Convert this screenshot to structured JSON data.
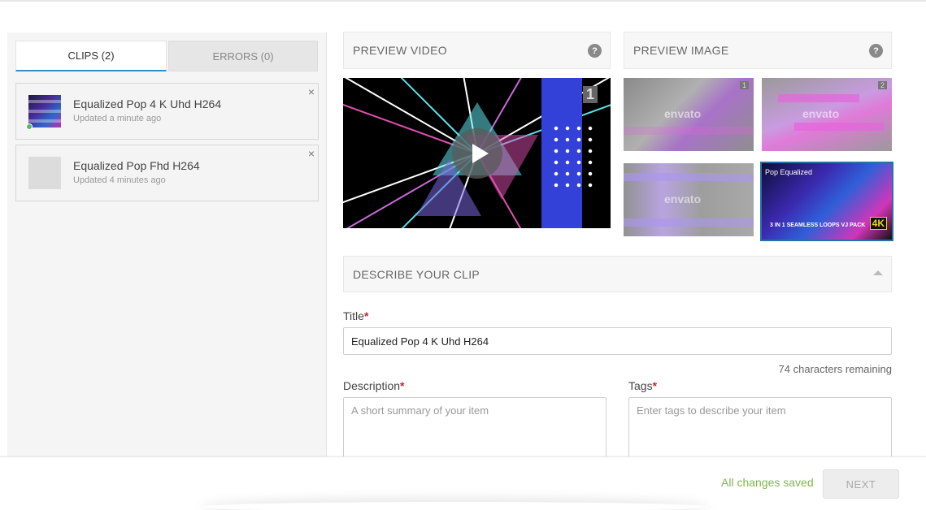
{
  "sidebar": {
    "tabs": [
      {
        "label": "CLIPS (2)",
        "active": true
      },
      {
        "label": "ERRORS (0)",
        "active": false
      }
    ],
    "clips": [
      {
        "title": "Equalized Pop 4 K Uhd H264",
        "updated": "Updated a minute ago",
        "thumbnail": "art",
        "status_color": "#5cb85c",
        "close_icon": "×"
      },
      {
        "title": "Equalized Pop Fhd H264",
        "updated": "Updated 4 minutes ago",
        "thumbnail": "blank",
        "close_icon": "×"
      }
    ]
  },
  "preview_video": {
    "header": "PREVIEW VIDEO",
    "help_icon": "?",
    "overlay_number": "1",
    "play_icon": "play-icon"
  },
  "preview_image": {
    "header": "PREVIEW IMAGE",
    "help_icon": "?",
    "thumbnails": [
      {
        "badge": "1",
        "watermark": "envato",
        "selected": false
      },
      {
        "badge": "2",
        "watermark": "envato",
        "selected": false
      },
      {
        "badge": "",
        "watermark": "envato",
        "selected": false
      },
      {
        "title": "Pop Equalized",
        "subtitle": "3 IN 1 SEAMLESS LOOPS VJ PACK",
        "resolution": "4K",
        "selected": true
      }
    ]
  },
  "describe": {
    "header": "DESCRIBE YOUR CLIP",
    "title_label": "Title",
    "required_mark": "*",
    "title_value": "Equalized Pop 4 K Uhd H264",
    "chars_remaining": "74 characters remaining",
    "description_label": "Description",
    "description_placeholder": "A short summary of your item",
    "tags_label": "Tags",
    "tags_placeholder": "Enter tags to describe your item"
  },
  "footer": {
    "status": "All changes saved",
    "next_label": "NEXT"
  },
  "colors": {
    "accent": "#2f8fc9",
    "required": "#c0262d",
    "saved": "#7db945",
    "selected_border": "#2a6fa8"
  }
}
